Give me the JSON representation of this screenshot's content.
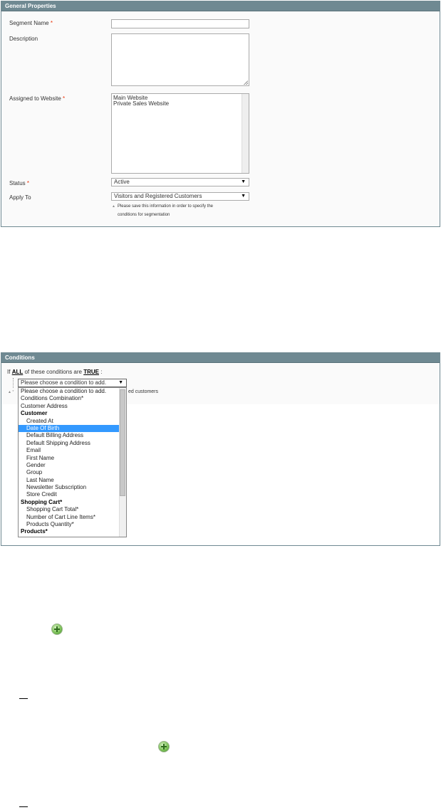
{
  "general": {
    "header": "General Properties",
    "segment_name_label": "Segment Name",
    "description_label": "Description",
    "website_label": "Assigned to Website",
    "websites": [
      "Main Website",
      "Private Sales Website"
    ],
    "status_label": "Status",
    "status_value": "Active",
    "apply_label": "Apply To",
    "apply_value": "Visitors and Registered Customers",
    "note_line1": "Please save this information in order to specify the",
    "note_line2": "conditions for segmentation",
    "required_mark": "*"
  },
  "conditions": {
    "header": "Conditions",
    "rule_prefix": "If",
    "rule_all": "ALL",
    "rule_middle": "of these conditions are",
    "rule_true": "TRUE",
    "rule_suffix": ":",
    "select_value": "Please choose a condition to add.",
    "hint_fragment": "ed customers",
    "dropdown": [
      {
        "label": "Please choose a condition to add.",
        "kind": "option"
      },
      {
        "label": "Conditions Combination*",
        "kind": "option"
      },
      {
        "label": "Customer Address",
        "kind": "option"
      },
      {
        "label": "Customer",
        "kind": "group"
      },
      {
        "label": "Created At",
        "kind": "indent"
      },
      {
        "label": "Date Of Birth",
        "kind": "indent",
        "selected": true
      },
      {
        "label": "Default Billing Address",
        "kind": "indent"
      },
      {
        "label": "Default Shipping Address",
        "kind": "indent"
      },
      {
        "label": "Email",
        "kind": "indent"
      },
      {
        "label": "First Name",
        "kind": "indent"
      },
      {
        "label": "Gender",
        "kind": "indent"
      },
      {
        "label": "Group",
        "kind": "indent"
      },
      {
        "label": "Last Name",
        "kind": "indent"
      },
      {
        "label": "Newsletter Subscription",
        "kind": "indent"
      },
      {
        "label": "Store Credit",
        "kind": "indent"
      },
      {
        "label": "Shopping Cart*",
        "kind": "group"
      },
      {
        "label": "Shopping Cart Total*",
        "kind": "indent"
      },
      {
        "label": "Number of Cart Line Items*",
        "kind": "indent"
      },
      {
        "label": "Products Quantity*",
        "kind": "indent"
      },
      {
        "label": "Products*",
        "kind": "group"
      }
    ]
  },
  "icons": {
    "add_condition_icon_1": "plus-circle-icon",
    "add_condition_icon_2": "plus-circle-icon"
  },
  "colors": {
    "header_bg": "#6f8992",
    "required": "#eb340a",
    "selected_option": "#3399ff"
  }
}
